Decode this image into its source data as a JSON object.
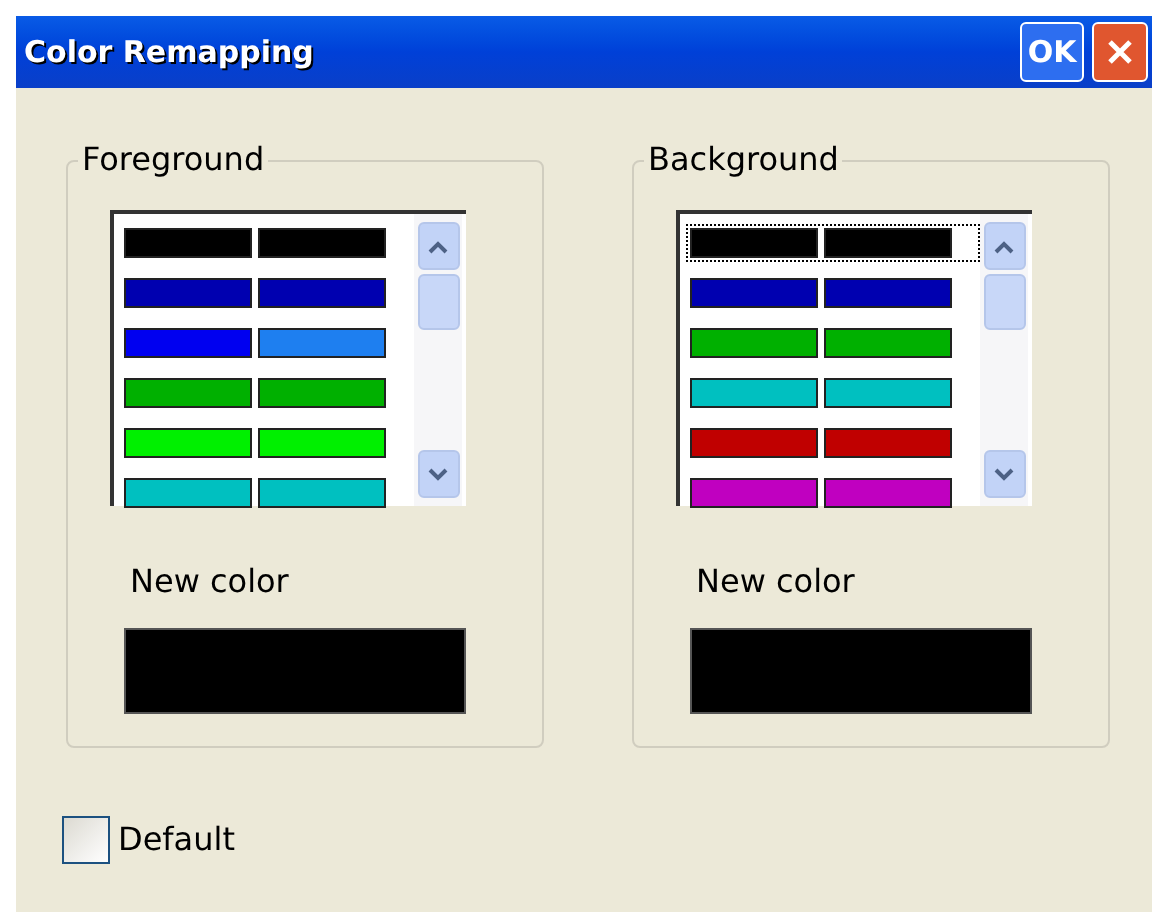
{
  "window": {
    "title": "Color Remapping",
    "ok_button": "OK"
  },
  "groups": [
    {
      "title": "Foreground",
      "rows": [
        {
          "swatches": [
            {
              "color": "#000000"
            },
            {
              "color": "#000000"
            }
          ],
          "selected": false
        },
        {
          "swatches": [
            {
              "color": "#0000b0"
            },
            {
              "color": "#0000b0"
            }
          ],
          "selected": false
        },
        {
          "swatches": [
            {
              "color": "#0000f0"
            },
            {
              "color": "#1e7ff0"
            }
          ],
          "selected": false
        },
        {
          "swatches": [
            {
              "color": "#00b000"
            },
            {
              "color": "#00b000"
            }
          ],
          "selected": false
        },
        {
          "swatches": [
            {
              "color": "#00f000"
            },
            {
              "color": "#00f000"
            }
          ],
          "selected": false
        },
        {
          "swatches": [
            {
              "color": "#00c0c0"
            },
            {
              "color": "#00c0c0"
            }
          ],
          "selected": false
        }
      ],
      "new_color_label": "New color",
      "new_color": {
        "color": "#000000"
      }
    },
    {
      "title": "Background",
      "rows": [
        {
          "swatches": [
            {
              "color": "#000000"
            },
            {
              "color": "#000000"
            }
          ],
          "selected": true
        },
        {
          "swatches": [
            {
              "color": "#0000b0"
            },
            {
              "color": "#0000b0"
            }
          ],
          "selected": false
        },
        {
          "swatches": [
            {
              "color": "#00b000"
            },
            {
              "color": "#00b000"
            }
          ],
          "selected": false
        },
        {
          "swatches": [
            {
              "color": "#00c0c0"
            },
            {
              "color": "#00c0c0"
            }
          ],
          "selected": false
        },
        {
          "swatches": [
            {
              "color": "#c00000"
            },
            {
              "color": "#c00000"
            }
          ],
          "selected": false
        },
        {
          "swatches": [
            {
              "color": "#c000c0"
            },
            {
              "color": "#c000c0"
            }
          ],
          "selected": false
        }
      ],
      "new_color_label": "New color",
      "new_color": {
        "color": "#000000"
      }
    }
  ],
  "default_checkbox": {
    "label": "Default",
    "checked": false
  }
}
